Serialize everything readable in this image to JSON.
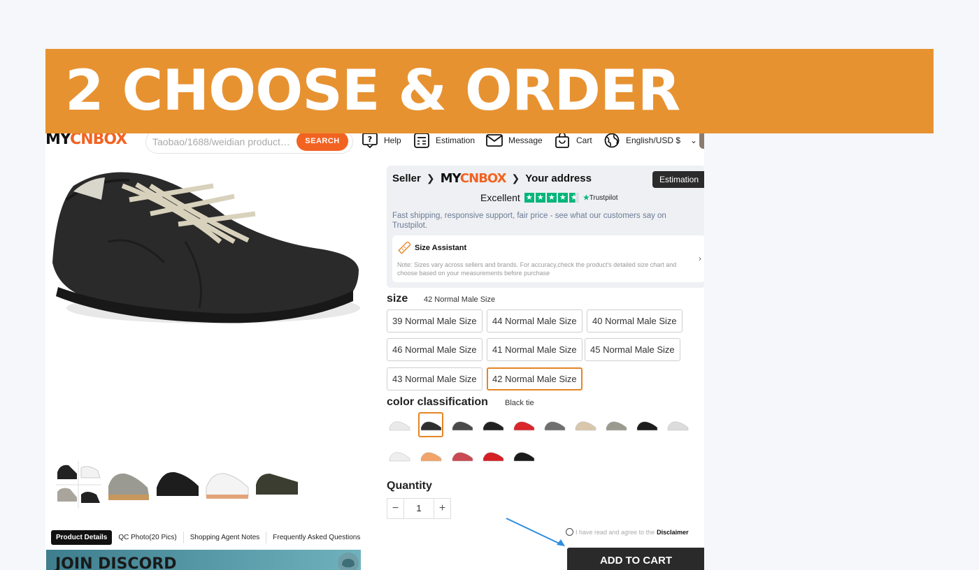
{
  "banner": {
    "title": "2 CHOOSE & ORDER"
  },
  "header": {
    "logo_part1": "MY",
    "logo_part2": "CNBOX",
    "search_placeholder": "Taobao/1688/weidian product link...",
    "search_button": "SEARCH",
    "nav": [
      {
        "label": "Help",
        "icon": "help-icon"
      },
      {
        "label": "Estimation",
        "icon": "calculator-icon"
      },
      {
        "label": "Message",
        "icon": "mail-icon"
      },
      {
        "label": "Cart",
        "icon": "cart-icon"
      },
      {
        "label": "English/USD $",
        "icon": "globe-icon"
      }
    ]
  },
  "product": {
    "thumbnails": [
      "thumb-collage",
      "thumb-grey-sneaker",
      "thumb-black-sneaker",
      "thumb-white-sneaker",
      "thumb-dark-sneaker"
    ],
    "tabs": [
      "Product Details",
      "QC Photo(20 Pics)",
      "Shopping Agent Notes",
      "Frequently Asked Questions"
    ],
    "promo": "JOIN DISCORD"
  },
  "seller_box": {
    "seller": "Seller",
    "logo_part1": "MY",
    "logo_part2": "CNBOX",
    "address": "Your address",
    "estimation_button": "Estimation",
    "rating_word": "Excellent",
    "trustpilot": "Trustpilot",
    "description": "Fast shipping, responsive support, fair price - see what our customers say on Trustpilot.",
    "size_assistant_title": "Size Assistant",
    "size_assistant_note": "Note: Sizes vary across sellers and brands. For accuracy,check the product's detailed size chart and choose based on your measurements before purchase"
  },
  "size": {
    "label": "size",
    "selected": "42 Normal Male Size",
    "options": [
      "39 Normal Male Size",
      "44 Normal Male Size",
      "40 Normal Male Size",
      "46 Normal Male Size",
      "41 Normal Male Size",
      "45 Normal Male Size",
      "43 Normal Male Size",
      "42 Normal Male Size"
    ]
  },
  "color": {
    "label": "color classification",
    "selected": "Black tie",
    "swatch_colors": [
      "#e9e9e9",
      "#2e2e2e",
      "#4a4a4a",
      "#222222",
      "#d9252b",
      "#6f6f6f",
      "#d8c7ad",
      "#9a9a8f",
      "#1c1c1c",
      "#dcdcdc",
      "#eeeeee",
      "#f2a46a",
      "#c94a52",
      "#d41f24",
      "#1a1a1a"
    ]
  },
  "quantity": {
    "label": "Quantity",
    "minus": "−",
    "value": "1",
    "plus": "+"
  },
  "checkout": {
    "agree_text": "I have read and agree to the",
    "disclaimer": "Disclaimer",
    "add_to_cart": "ADD TO CART",
    "accent": "#f26322",
    "banner_color": "#e79231",
    "selected_border": "#e58525"
  }
}
